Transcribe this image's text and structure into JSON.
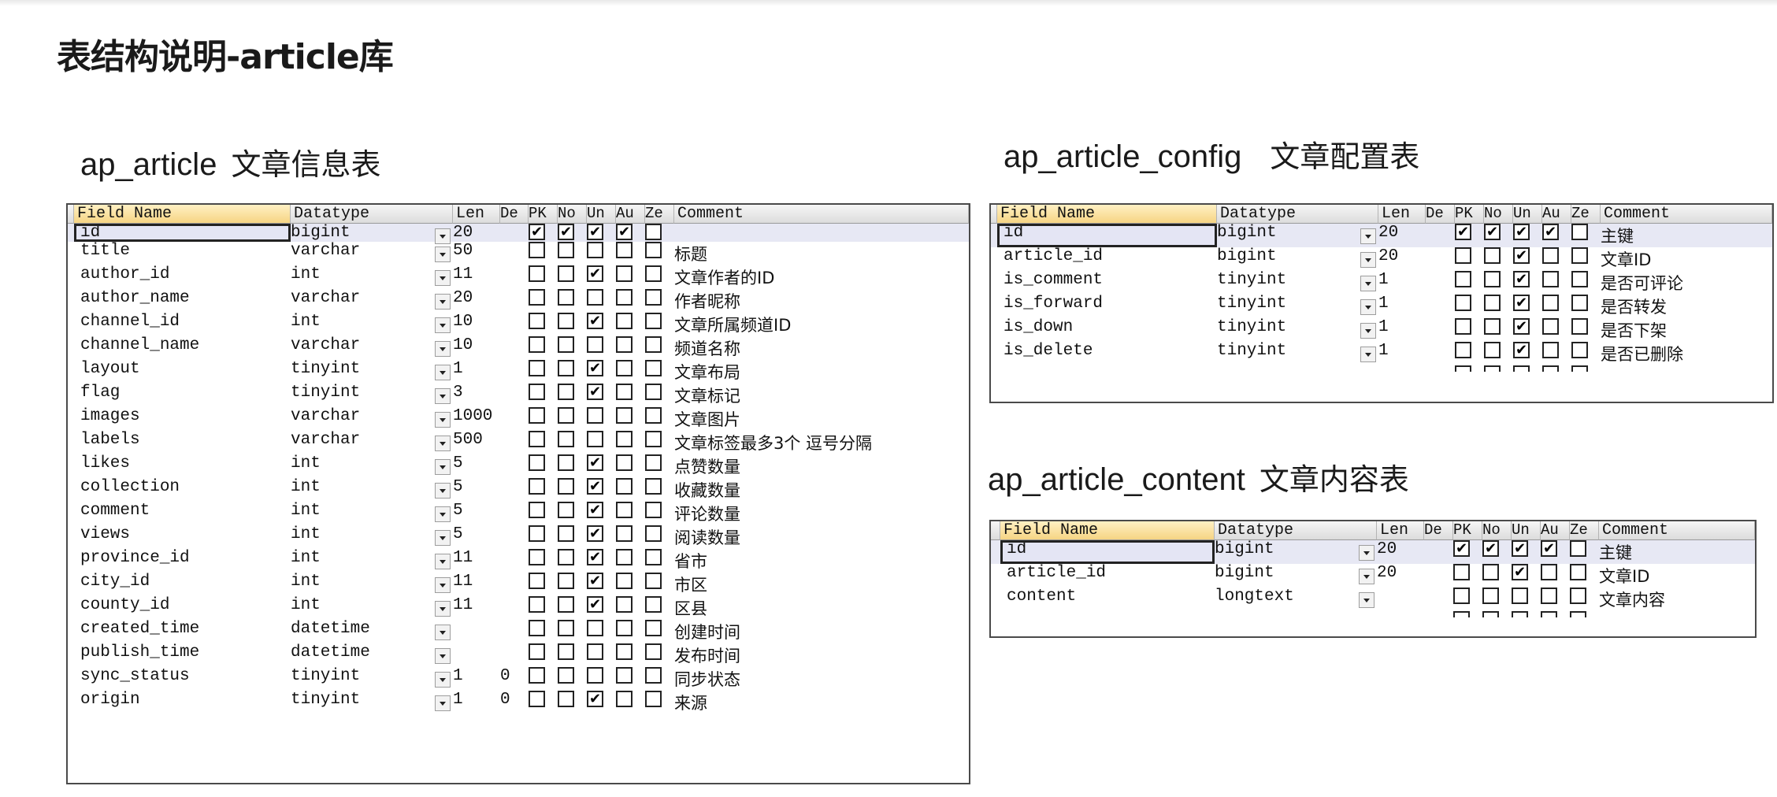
{
  "page_title": "表结构说明-article库",
  "headers": {
    "field_name": "Field Name",
    "datatype": "Datatype",
    "len": "Len",
    "de": "De",
    "pk": "PK",
    "no": "No",
    "un": "Un",
    "au": "Au",
    "ze": "Ze",
    "comment": "Comment"
  },
  "tables": [
    {
      "name": "ap_article",
      "cn_name": "文章信息表",
      "rows": [
        {
          "field": "id",
          "type": "bigint",
          "len": "20",
          "de": "",
          "pk": true,
          "no": true,
          "un": true,
          "au": true,
          "ze": false,
          "comment": ""
        },
        {
          "field": "title",
          "type": "varchar",
          "len": "50",
          "de": "",
          "pk": false,
          "no": false,
          "un": false,
          "au": false,
          "ze": false,
          "comment": "标题"
        },
        {
          "field": "author_id",
          "type": "int",
          "len": "11",
          "de": "",
          "pk": false,
          "no": false,
          "un": true,
          "au": false,
          "ze": false,
          "comment": "文章作者的ID"
        },
        {
          "field": "author_name",
          "type": "varchar",
          "len": "20",
          "de": "",
          "pk": false,
          "no": false,
          "un": false,
          "au": false,
          "ze": false,
          "comment": "作者昵称"
        },
        {
          "field": "channel_id",
          "type": "int",
          "len": "10",
          "de": "",
          "pk": false,
          "no": false,
          "un": true,
          "au": false,
          "ze": false,
          "comment": "文章所属频道ID"
        },
        {
          "field": "channel_name",
          "type": "varchar",
          "len": "10",
          "de": "",
          "pk": false,
          "no": false,
          "un": false,
          "au": false,
          "ze": false,
          "comment": "频道名称"
        },
        {
          "field": "layout",
          "type": "tinyint",
          "len": "1",
          "de": "",
          "pk": false,
          "no": false,
          "un": true,
          "au": false,
          "ze": false,
          "comment": "文章布局"
        },
        {
          "field": "flag",
          "type": "tinyint",
          "len": "3",
          "de": "",
          "pk": false,
          "no": false,
          "un": true,
          "au": false,
          "ze": false,
          "comment": "文章标记"
        },
        {
          "field": "images",
          "type": "varchar",
          "len": "1000",
          "de": "",
          "pk": false,
          "no": false,
          "un": false,
          "au": false,
          "ze": false,
          "comment": "文章图片"
        },
        {
          "field": "labels",
          "type": "varchar",
          "len": "500",
          "de": "",
          "pk": false,
          "no": false,
          "un": false,
          "au": false,
          "ze": false,
          "comment": "文章标签最多3个 逗号分隔"
        },
        {
          "field": "likes",
          "type": "int",
          "len": "5",
          "de": "",
          "pk": false,
          "no": false,
          "un": true,
          "au": false,
          "ze": false,
          "comment": "点赞数量"
        },
        {
          "field": "collection",
          "type": "int",
          "len": "5",
          "de": "",
          "pk": false,
          "no": false,
          "un": true,
          "au": false,
          "ze": false,
          "comment": "收藏数量"
        },
        {
          "field": "comment",
          "type": "int",
          "len": "5",
          "de": "",
          "pk": false,
          "no": false,
          "un": true,
          "au": false,
          "ze": false,
          "comment": "评论数量"
        },
        {
          "field": "views",
          "type": "int",
          "len": "5",
          "de": "",
          "pk": false,
          "no": false,
          "un": true,
          "au": false,
          "ze": false,
          "comment": "阅读数量"
        },
        {
          "field": "province_id",
          "type": "int",
          "len": "11",
          "de": "",
          "pk": false,
          "no": false,
          "un": true,
          "au": false,
          "ze": false,
          "comment": "省市"
        },
        {
          "field": "city_id",
          "type": "int",
          "len": "11",
          "de": "",
          "pk": false,
          "no": false,
          "un": true,
          "au": false,
          "ze": false,
          "comment": "市区"
        },
        {
          "field": "county_id",
          "type": "int",
          "len": "11",
          "de": "",
          "pk": false,
          "no": false,
          "un": true,
          "au": false,
          "ze": false,
          "comment": "区县"
        },
        {
          "field": "created_time",
          "type": "datetime",
          "len": "",
          "de": "",
          "pk": false,
          "no": false,
          "un": false,
          "au": false,
          "ze": false,
          "comment": "创建时间"
        },
        {
          "field": "publish_time",
          "type": "datetime",
          "len": "",
          "de": "",
          "pk": false,
          "no": false,
          "un": false,
          "au": false,
          "ze": false,
          "comment": "发布时间"
        },
        {
          "field": "sync_status",
          "type": "tinyint",
          "len": "1",
          "de": "0",
          "pk": false,
          "no": false,
          "un": false,
          "au": false,
          "ze": false,
          "comment": "同步状态"
        },
        {
          "field": "origin",
          "type": "tinyint",
          "len": "1",
          "de": "0",
          "pk": false,
          "no": false,
          "un": true,
          "au": false,
          "ze": false,
          "comment": "来源"
        }
      ]
    },
    {
      "name": "ap_article_config",
      "cn_name": "文章配置表",
      "rows": [
        {
          "field": "id",
          "type": "bigint",
          "len": "20",
          "de": "",
          "pk": true,
          "no": true,
          "un": true,
          "au": true,
          "ze": false,
          "comment": "主键"
        },
        {
          "field": "article_id",
          "type": "bigint",
          "len": "20",
          "de": "",
          "pk": false,
          "no": false,
          "un": true,
          "au": false,
          "ze": false,
          "comment": "文章ID"
        },
        {
          "field": "is_comment",
          "type": "tinyint",
          "len": "1",
          "de": "",
          "pk": false,
          "no": false,
          "un": true,
          "au": false,
          "ze": false,
          "comment": "是否可评论"
        },
        {
          "field": "is_forward",
          "type": "tinyint",
          "len": "1",
          "de": "",
          "pk": false,
          "no": false,
          "un": true,
          "au": false,
          "ze": false,
          "comment": "是否转发"
        },
        {
          "field": "is_down",
          "type": "tinyint",
          "len": "1",
          "de": "",
          "pk": false,
          "no": false,
          "un": true,
          "au": false,
          "ze": false,
          "comment": "是否下架"
        },
        {
          "field": "is_delete",
          "type": "tinyint",
          "len": "1",
          "de": "",
          "pk": false,
          "no": false,
          "un": true,
          "au": false,
          "ze": false,
          "comment": "是否已删除"
        }
      ]
    },
    {
      "name": "ap_article_content",
      "cn_name": "文章内容表",
      "rows": [
        {
          "field": "id",
          "type": "bigint",
          "len": "20",
          "de": "",
          "pk": true,
          "no": true,
          "un": true,
          "au": true,
          "ze": false,
          "comment": "主键"
        },
        {
          "field": "article_id",
          "type": "bigint",
          "len": "20",
          "de": "",
          "pk": false,
          "no": false,
          "un": true,
          "au": false,
          "ze": false,
          "comment": "文章ID"
        },
        {
          "field": "content",
          "type": "longtext",
          "len": "",
          "de": "",
          "pk": false,
          "no": false,
          "un": false,
          "au": false,
          "ze": false,
          "comment": "文章内容"
        }
      ]
    }
  ]
}
